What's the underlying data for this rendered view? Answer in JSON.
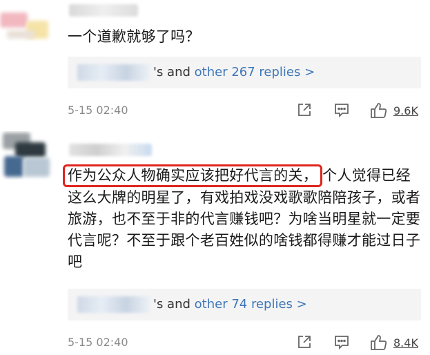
{
  "comments": [
    {
      "text": "一个道歉就够了吗？",
      "replies": {
        "suffix": "'s and",
        "link": "other 267 replies >"
      },
      "time": "5-15 02:40",
      "likes": "9.6K"
    },
    {
      "highlight": "作为公众人物确实应该把好代言的关，",
      "text": "个人觉得已经这么大牌的明星了，有戏拍戏没戏歌歌陪陪孩子，或者旅游，也不至于非的代言赚钱吧？为啥当明星就一定要代言呢？不至于跟个老百姓似的啥钱都得赚才能过日子吧",
      "replies": {
        "suffix": "'s and",
        "link": "other 74 replies >"
      },
      "time": "5-15 02:40",
      "likes": "8.4K"
    }
  ],
  "icons": {
    "share": "share-icon",
    "comment": "comment-icon",
    "like": "thumbs-up-icon"
  },
  "colors": {
    "link": "#3e76b8",
    "highlight_border": "#e0241d",
    "reply_bg": "#f4f4f4",
    "meta": "#8a8a8a"
  }
}
